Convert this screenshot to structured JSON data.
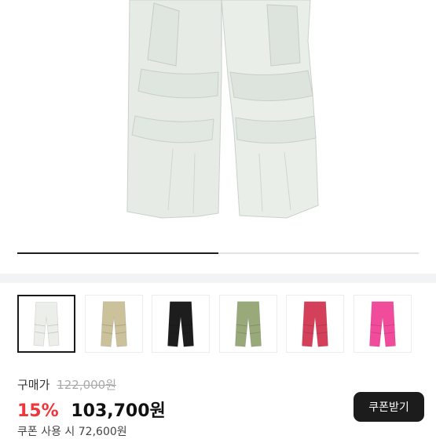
{
  "product": {
    "image_icon": "cargo-pants-photo",
    "carousel_progress": 0.5
  },
  "thumbnails": [
    {
      "color_name": "white",
      "color": "#eceee9",
      "selected": true
    },
    {
      "color_name": "beige",
      "color": "#cbc19a",
      "selected": false
    },
    {
      "color_name": "black",
      "color": "#1d1d1d",
      "selected": false
    },
    {
      "color_name": "sage green",
      "color": "#9aa97a",
      "selected": false
    },
    {
      "color_name": "red",
      "color": "#d4405a",
      "selected": false
    },
    {
      "color_name": "pink",
      "color": "#f14c9b",
      "selected": false
    }
  ],
  "price": {
    "label": "구매가",
    "original": "122,000원",
    "discount": "15%",
    "final": "103,700원",
    "coupon_prefix": "쿠폰 사용 시",
    "coupon_price": "72,600원"
  },
  "buttons": {
    "coupon": "쿠폰받기"
  },
  "colors": {
    "accent_red": "#f0353b",
    "button_dark": "#1c1c1c"
  }
}
